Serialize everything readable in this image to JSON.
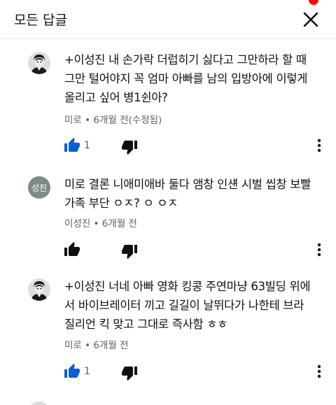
{
  "header": {
    "title": "모든 답글"
  },
  "icons": {
    "close": "close-icon",
    "like": "thumb-up-icon",
    "dislike": "thumb-down-icon",
    "more": "more-vertical-icon"
  },
  "colors": {
    "accent": "#065fd4",
    "icon_dark": "#0f0f0f",
    "meta_text": "#606060",
    "notification": "#ff0000",
    "avatar_bg": "#7b8d8b"
  },
  "comments": [
    {
      "avatar": "portrait-photo",
      "lines": [
        "+이성진 내 손가락 더럽히기 싫다고 그만하라 할 때",
        "그만 털어야지 꼭 엄마 아빠를 남의 입방아에 이렇게",
        "올리고 싶어 병1쉰아?"
      ],
      "meta": "미로 • 6개월 전(수정됨)",
      "likes": "1",
      "liked": true
    },
    {
      "avatar_text": "성진",
      "lines": [
        "미로 결론 니애미애바 둘다 앰창 인섄 시벌 씹창 보빨",
        "가족 부단 ㅇㅈ? ㅇ ㅇㅈ"
      ],
      "meta": "이성진 • 6개월 전",
      "likes": "",
      "liked": false
    },
    {
      "avatar": "portrait-photo",
      "lines": [
        "+이성진 너네 아빠 영화 킹콩 주연마냥 63빌딩 위에",
        "서 바이브레이터 끼고 길길이 날뛰다가 나한테 브라",
        "질리언 킥 맞고 그대로 즉사함 ㅎㅎ"
      ],
      "meta": "미로 • 6개월 전",
      "likes": "1",
      "liked": true
    }
  ]
}
